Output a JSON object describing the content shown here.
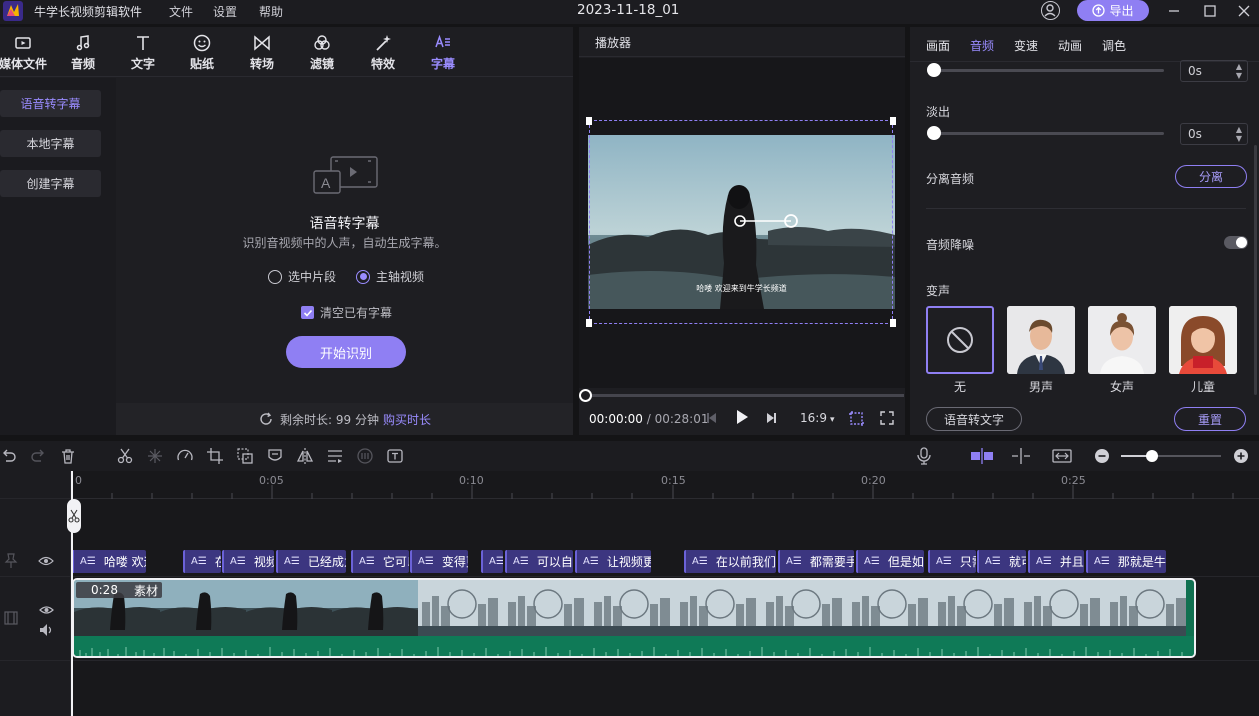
{
  "titlebar": {
    "app_name": "牛学长视频剪辑软件",
    "menus": [
      "文件",
      "设置",
      "帮助"
    ],
    "doc_title": "2023-11-18_01",
    "export_label": "导出",
    "icons": [
      "app-logo-icon",
      "user-avatar-icon",
      "export-upload-icon",
      "minimize-icon",
      "maximize-icon",
      "close-icon"
    ]
  },
  "toolbar": {
    "items": [
      {
        "label": "媒体文件",
        "icon": "media-icon"
      },
      {
        "label": "音频",
        "icon": "music-note-icon"
      },
      {
        "label": "文字",
        "icon": "text-icon"
      },
      {
        "label": "贴纸",
        "icon": "sticker-icon"
      },
      {
        "label": "转场",
        "icon": "transition-icon"
      },
      {
        "label": "滤镜",
        "icon": "filter-icon"
      },
      {
        "label": "特效",
        "icon": "effects-icon"
      },
      {
        "label": "字幕",
        "icon": "subtitle-icon",
        "active": true
      }
    ]
  },
  "subnav": {
    "items": [
      "语音转字幕",
      "本地字幕",
      "创建字幕"
    ],
    "active_index": 0
  },
  "speech_to_subtitle": {
    "title": "语音转字幕",
    "description": "识别音视频中的人声，自动生成字幕。",
    "options": [
      "选中片段",
      "主轴视频"
    ],
    "selected_option": "主轴视频",
    "clear_label": "清空已有字幕",
    "clear_checked": true,
    "start_button": "开始识别",
    "remain_text": "剩余时长: 99 分钟",
    "buy_link": "购买时长"
  },
  "player": {
    "title": "播放器",
    "caption": "哈喽 欢迎来到牛学长频道",
    "current_time": "00:00:00",
    "separator": " / ",
    "total_time": "00:28:01",
    "aspect": "16:9",
    "progress": 0
  },
  "right_panel": {
    "tabs": [
      "画面",
      "音频",
      "变速",
      "动画",
      "调色"
    ],
    "active_tab": "音频",
    "fade_in_value": "0s",
    "fade_out_label": "淡出",
    "fade_out_value": "0s",
    "separate_audio_label": "分离音频",
    "separate_button": "分离",
    "denoise_label": "音频降噪",
    "denoise_on": false,
    "voice_change_label": "变声",
    "voices": [
      "无",
      "男声",
      "女声",
      "儿童"
    ],
    "selected_voice": "无",
    "speech_to_text_button": "语音转文字",
    "reset_button": "重置"
  },
  "timeline": {
    "ruler_ticks": [
      "0",
      "0:05",
      "0:10",
      "0:15",
      "0:20",
      "0:25"
    ],
    "subtitle_clips": [
      "哈喽 欢迎",
      "在",
      "视频",
      "已经成为",
      "它可以",
      "变得更",
      "",
      "可以自",
      "让视频更",
      "在以前我们",
      "都需要手",
      "但是如",
      "只需",
      "就可",
      "并且",
      "那就是牛"
    ],
    "clip_duration": "0:28",
    "clip_name": "素材",
    "accent_color": "#8f7ff3",
    "waveform_color": "#0f7a57"
  }
}
